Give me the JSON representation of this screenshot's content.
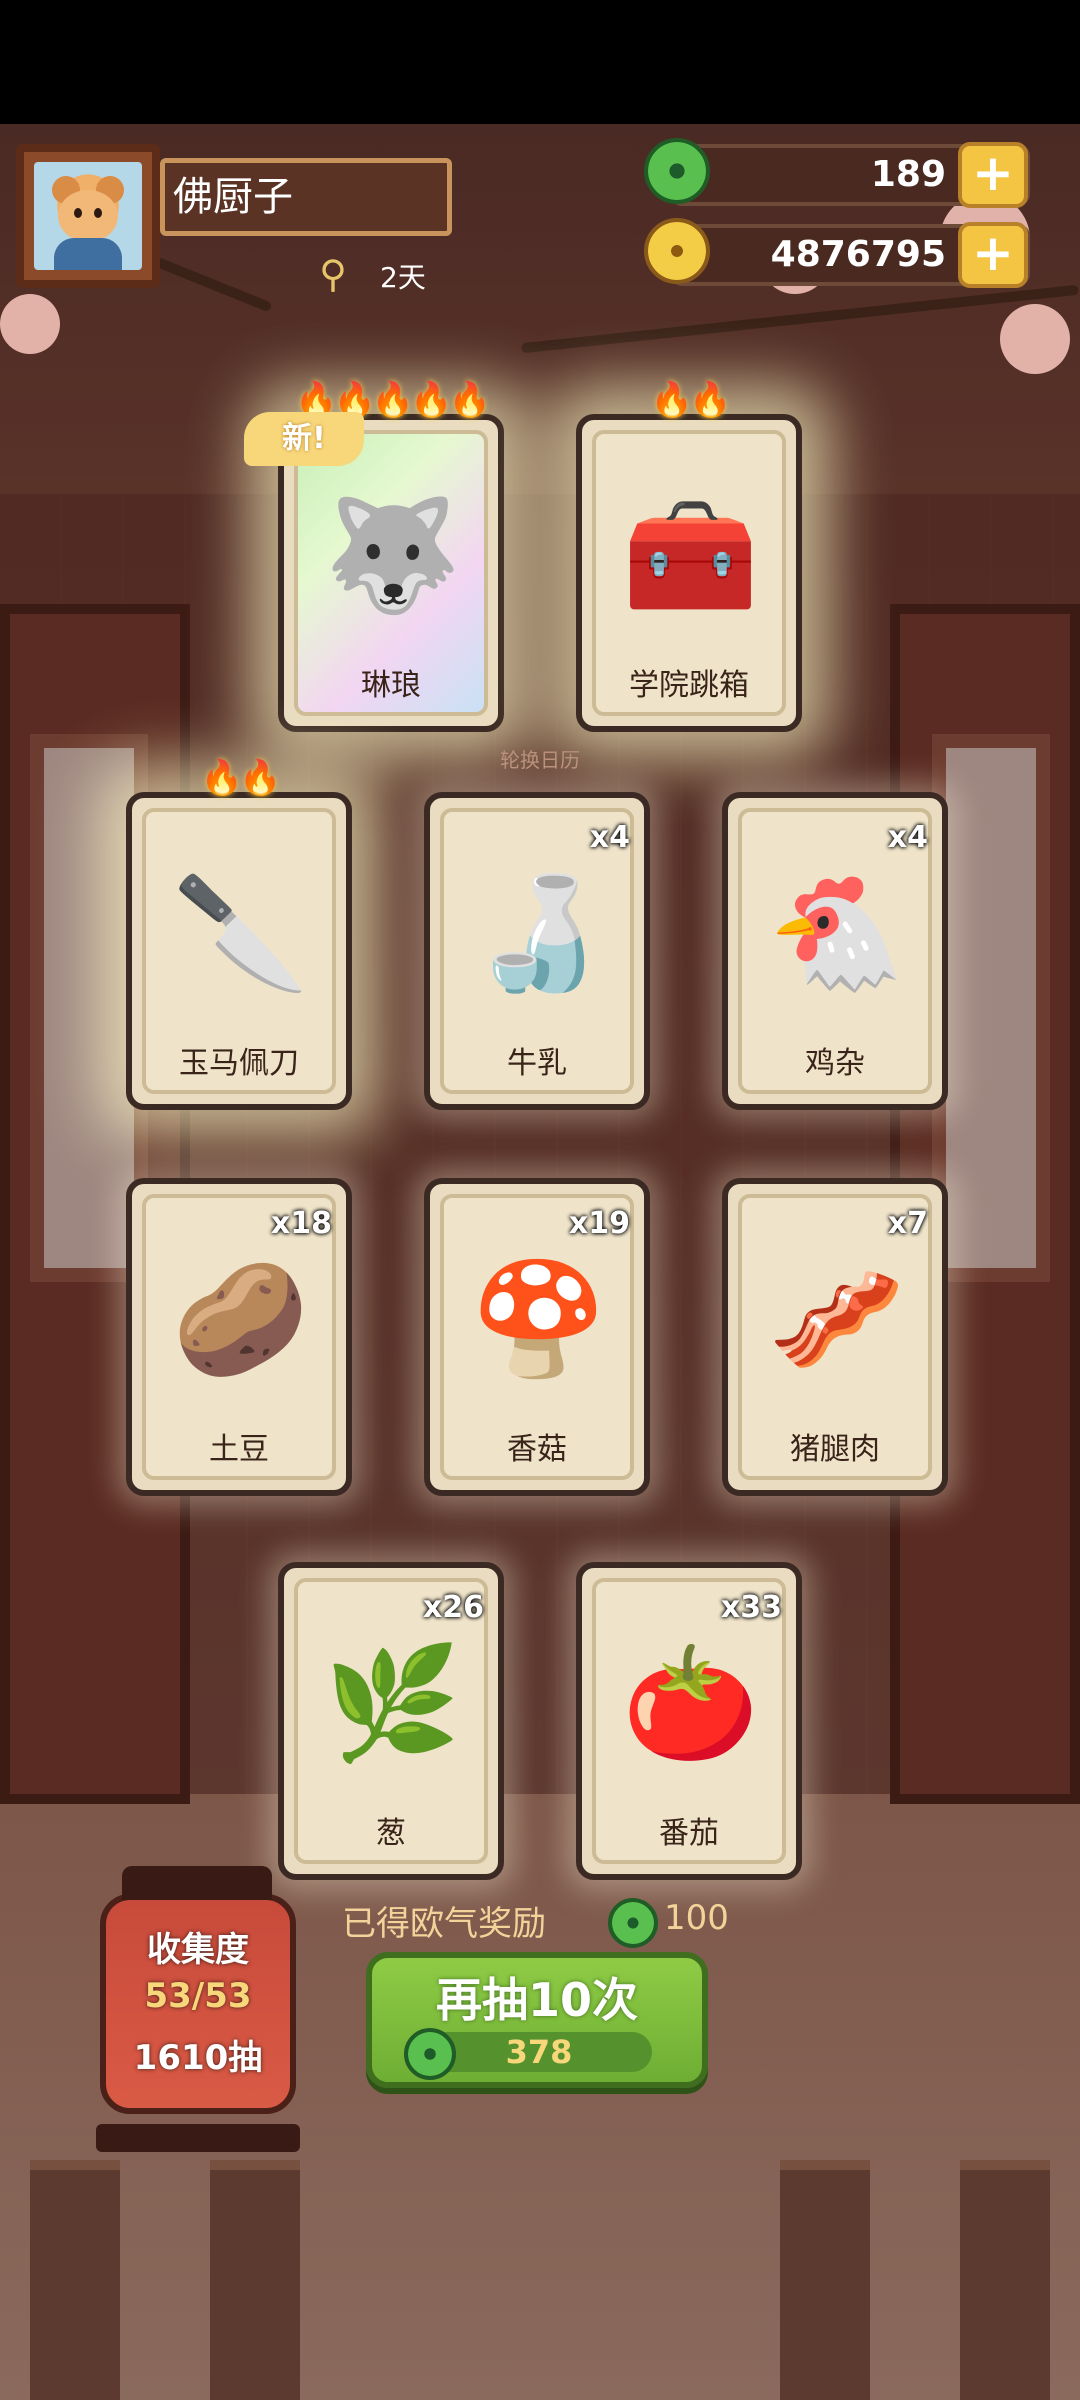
{
  "header": {
    "player_name": "佛厨子",
    "days": "2天",
    "jade_amount": "189",
    "gold_amount": "4876795",
    "plus_label": "+"
  },
  "cards_top": [
    {
      "name": "琳琅",
      "count": "",
      "flames": "🔥🔥🔥🔥🔥",
      "badge": "新!"
    },
    {
      "name": "学院跳箱",
      "count": "",
      "flames": "🔥🔥",
      "badge": ""
    }
  ],
  "bg_caption": "轮换日历",
  "cards_mid": [
    {
      "name": "玉马佩刀",
      "count": "",
      "flames": "🔥🔥"
    },
    {
      "name": "牛乳",
      "count": "x4",
      "flames": ""
    },
    {
      "name": "鸡杂",
      "count": "x4",
      "flames": ""
    }
  ],
  "cards_row3": [
    {
      "name": "土豆",
      "count": "x18"
    },
    {
      "name": "香菇",
      "count": "x19"
    },
    {
      "name": "猪腿肉",
      "count": "x7"
    }
  ],
  "cards_row4": [
    {
      "name": "葱",
      "count": "x26"
    },
    {
      "name": "番茄",
      "count": "x33"
    }
  ],
  "collection": {
    "label": "收集度",
    "progress": "53/53",
    "draws": "1610抽"
  },
  "reward": {
    "label": "已得欧气奖励",
    "value": "100"
  },
  "draw_button": {
    "label": "再抽10次",
    "cost": "378"
  },
  "colors": {
    "jade": "#59c04f",
    "gold": "#f4cd46",
    "button_green": "#7dbb3c",
    "lantern_red": "#d95a45"
  }
}
